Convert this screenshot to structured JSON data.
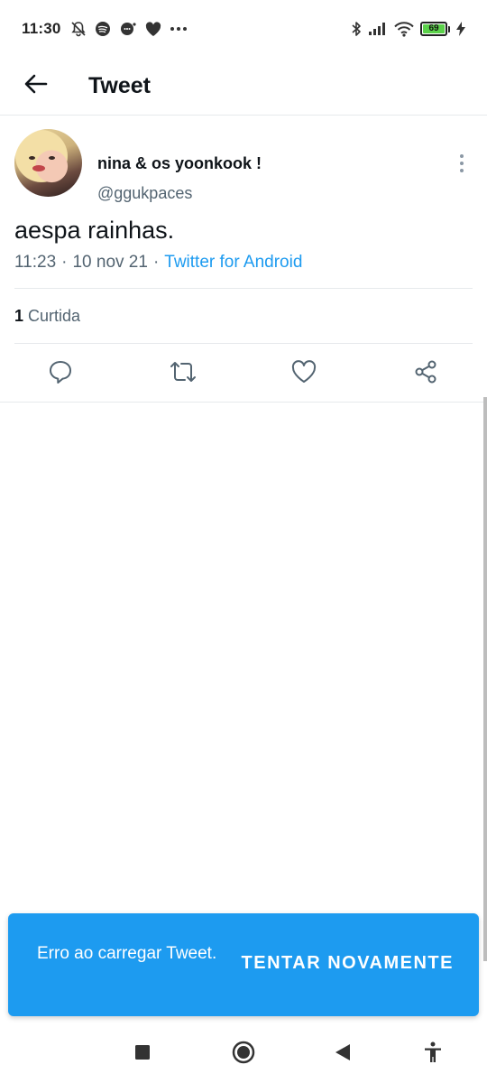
{
  "status_bar": {
    "time": "11:30",
    "left_icons": [
      "bell-off-icon",
      "spotify-icon",
      "chat-bubble-icon",
      "heart-icon",
      "more-dots-icon"
    ],
    "right_icons": [
      "bluetooth-icon",
      "signal-icon",
      "wifi-icon"
    ],
    "battery_level": "69"
  },
  "header": {
    "back_icon": "arrow-left-icon",
    "title": "Tweet"
  },
  "tweet": {
    "display_name": "nina & os yoonkook !",
    "handle": "@ggukpaces",
    "text": "aespa rainhas.",
    "time": "11:23",
    "date": "10 nov 21",
    "separator": "·",
    "source": "Twitter for Android",
    "likes_count": "1",
    "likes_label": "Curtida"
  },
  "actions": [
    "reply-icon",
    "retweet-icon",
    "like-icon",
    "share-icon"
  ],
  "snackbar": {
    "message": "Erro ao carregar Tweet.",
    "action_label": "TENTAR NOVAMENTE"
  },
  "nav_bar": [
    "recents-square-icon",
    "home-circle-icon",
    "back-triangle-icon",
    "accessibility-icon"
  ],
  "colors": {
    "accent": "#1d9bf0",
    "text_primary": "#0f1419",
    "text_secondary": "#536471",
    "battery_fill": "#5bd14a"
  }
}
